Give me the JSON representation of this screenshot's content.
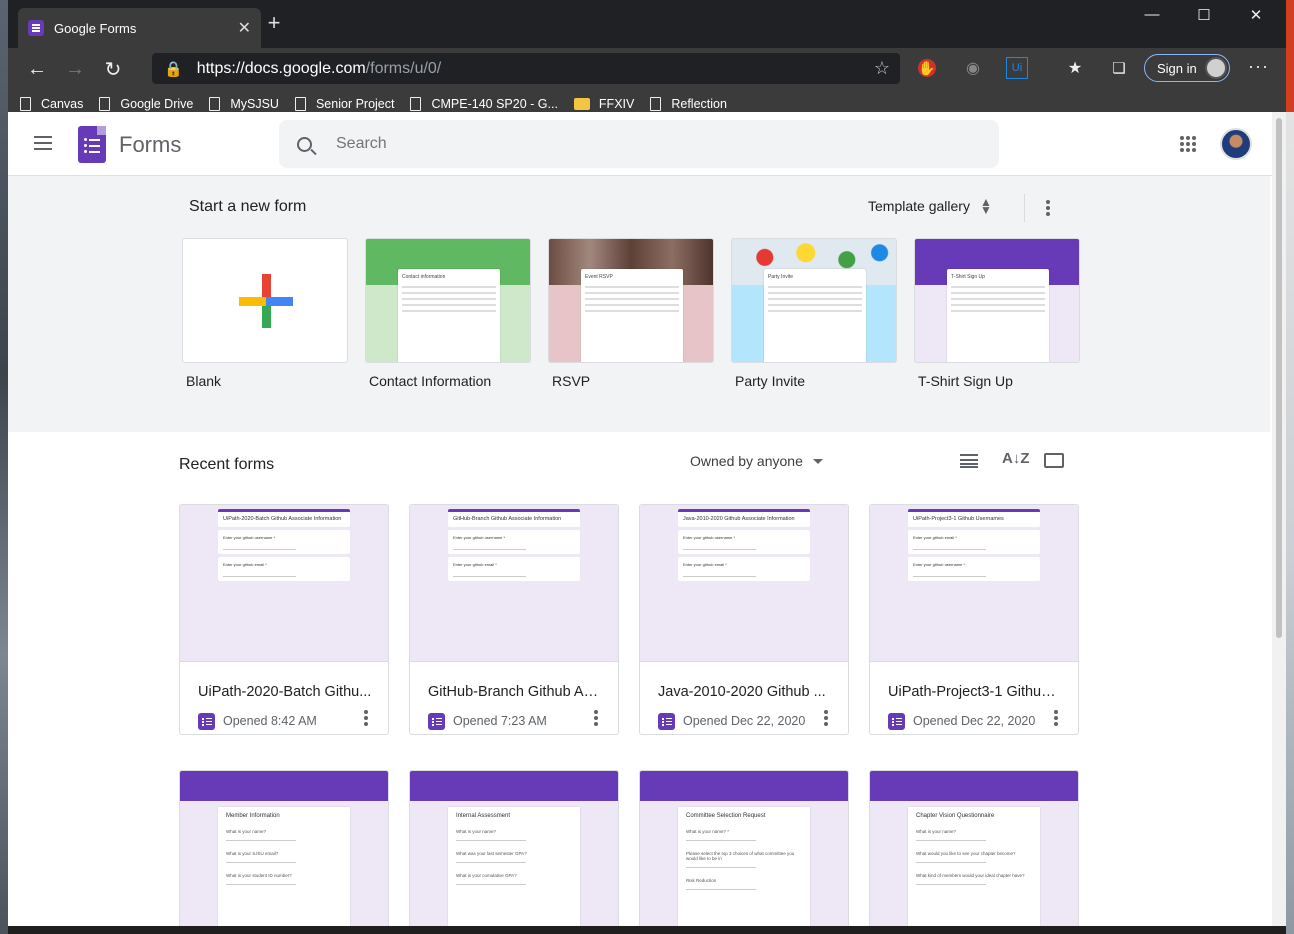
{
  "browser": {
    "tab_title": "Google Forms",
    "tab_close": "✕",
    "new_tab": "+",
    "url_host": "https://docs.google.com",
    "url_path": "/forms/u/0/",
    "signin_label": "Sign in",
    "bookmarks": [
      "Canvas",
      "Google Drive",
      "MySJSU",
      "Senior Project",
      "CMPE-140 SP20 - G...",
      "FFXIV",
      "Reflection"
    ]
  },
  "app": {
    "name": "Forms",
    "search_placeholder": "Search"
  },
  "start": {
    "title": "Start a new form",
    "template_gallery": "Template gallery",
    "templates": [
      "Blank",
      "Contact Information",
      "RSVP",
      "Party Invite",
      "T-Shirt Sign Up"
    ],
    "thumb_titles": {
      "contact": "Contact information",
      "rsvp": "Event RSVP",
      "party": "Party Invite",
      "tshirt": "T-Shirt Sign Up"
    }
  },
  "recent": {
    "title": "Recent forms",
    "owner_filter": "Owned by anyone",
    "cards": [
      {
        "name": "UiPath-2020-Batch Githu...",
        "opened": "Opened 8:42 AM",
        "thumb_title": "UiPath-2020-Batch Github Associate Information",
        "q1": "Enter your github username *",
        "q2": "Enter your github email *"
      },
      {
        "name": "GitHub-Branch Github As...",
        "opened": "Opened 7:23 AM",
        "thumb_title": "GitHub-Branch Github Associate Information",
        "q1": "Enter your github username *",
        "q2": "Enter your github email *"
      },
      {
        "name": "Java-2010-2020 Github ...",
        "opened": "Opened Dec 22, 2020",
        "thumb_title": "Java-2010-2020 Github Associate Information",
        "q1": "Enter your github username *",
        "q2": "Enter your github email *"
      },
      {
        "name": "UiPath-Project3-1 Github ...",
        "opened": "Opened Dec 22, 2020",
        "thumb_title": "UiPath-Project3-1 Github Usernames",
        "q1": "Enter your github email *",
        "q2": "Enter your github username *"
      }
    ],
    "cards2": [
      {
        "thumb_title": "Member Information",
        "q1": "What is your name?",
        "q2": "What is your SJSU email?",
        "q3": "What is your student ID number?"
      },
      {
        "thumb_title": "Internal Assessment",
        "q1": "What is your name?",
        "q2": "What was your last semester GPA?",
        "q3": "What is your cumulative GPA?"
      },
      {
        "thumb_title": "Committee Selection Request",
        "q1": "What is your name? *",
        "q2": "Please select the top 3 choices of what committee you would like to be in",
        "q3": "Risk Reduction"
      },
      {
        "thumb_title": "Chapter Vision Questionnaire",
        "q1": "What is your name?",
        "q2": "What would you like to see your chapter become?",
        "q3": "What kind of members would your ideal chapter have?"
      }
    ]
  },
  "colors": {
    "brand": "#673ab7",
    "thumb_bg": "#ede7f6"
  }
}
